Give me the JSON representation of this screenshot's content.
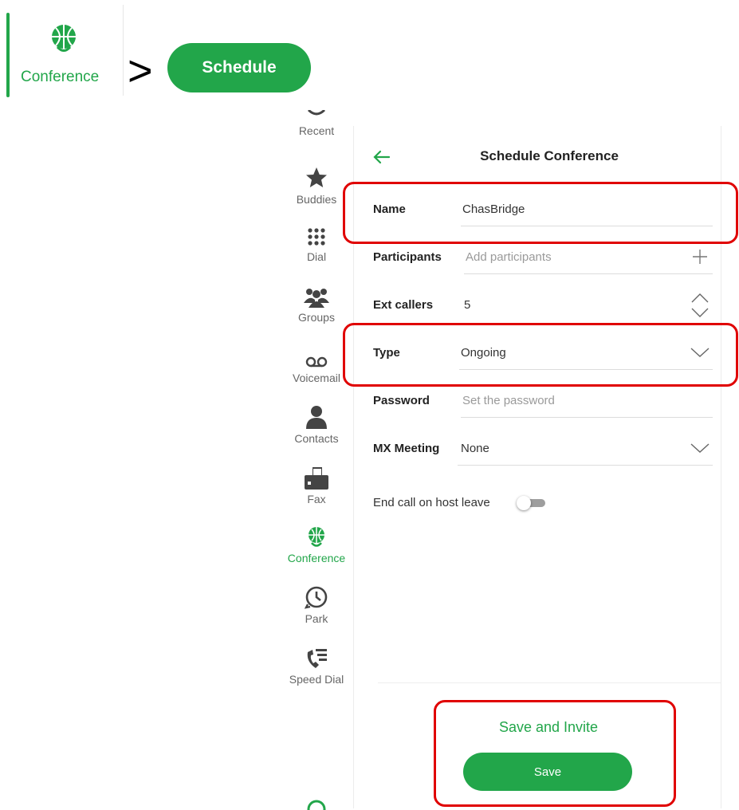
{
  "instruction": {
    "conference_label": "Conference",
    "arrow": ">",
    "schedule_label": "Schedule"
  },
  "sidebar": {
    "items": [
      {
        "label": "Recent",
        "icon": "clock-partial-icon"
      },
      {
        "label": "Buddies",
        "icon": "star-icon"
      },
      {
        "label": "Dial",
        "icon": "dialpad-icon"
      },
      {
        "label": "Groups",
        "icon": "group-icon"
      },
      {
        "label": "Voicemail",
        "icon": "voicemail-icon"
      },
      {
        "label": "Contacts",
        "icon": "person-icon"
      },
      {
        "label": "Fax",
        "icon": "fax-icon"
      },
      {
        "label": "Conference",
        "icon": "globe-headset-icon",
        "active": true
      },
      {
        "label": "Park",
        "icon": "park-clock-icon"
      },
      {
        "label": "Speed Dial",
        "icon": "speed-dial-icon"
      }
    ]
  },
  "header": {
    "title": "Schedule Conference"
  },
  "form": {
    "name": {
      "label": "Name",
      "value": "ChasBridge"
    },
    "participants": {
      "label": "Participants",
      "placeholder": "Add participants"
    },
    "ext_callers": {
      "label": "Ext callers",
      "value": "5"
    },
    "type": {
      "label": "Type",
      "value": "Ongoing"
    },
    "password": {
      "label": "Password",
      "placeholder": "Set the password"
    },
    "mx_meeting": {
      "label": "MX Meeting",
      "value": "None"
    },
    "end_call": {
      "label": "End call on host leave",
      "enabled": false
    }
  },
  "footer": {
    "save_invite_label": "Save and Invite",
    "save_label": "Save"
  },
  "colors": {
    "accent": "#22a64a",
    "highlight": "#e00000"
  }
}
